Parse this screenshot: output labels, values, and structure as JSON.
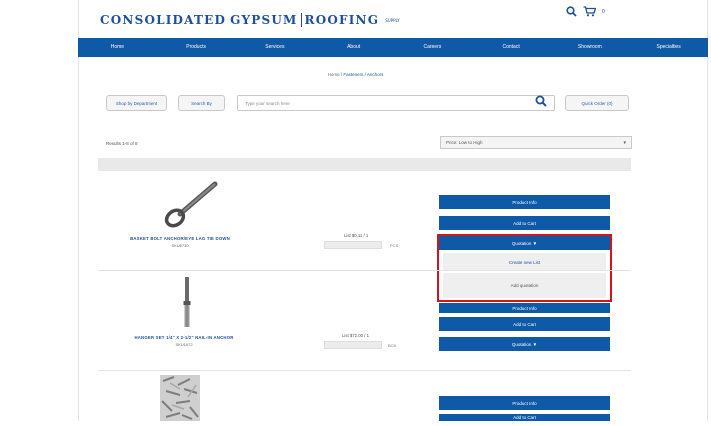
{
  "header": {
    "brand": {
      "word1": "CONSOLIDATED",
      "word2": "GYPSUM",
      "word3": "ROOFING",
      "suffix": "SUPPLY"
    },
    "cart_count": "0"
  },
  "nav": {
    "items": [
      "Home",
      "Products",
      "Services",
      "About",
      "Careers",
      "Contact",
      "Showroom",
      "Specialties"
    ]
  },
  "breadcrumb": {
    "home": "Home",
    "path": " / Fasteners / Anchors"
  },
  "toolbar": {
    "shop_by_department": "Shop by Department",
    "search_by": "Search By",
    "search_placeholder": "Type your search here",
    "quick_order": "Quick Order (0)"
  },
  "results": {
    "count_label": "Results 1-8 of 8",
    "sort_selected": "Price: Low to High"
  },
  "products": [
    {
      "name": "BASKET BOLT ANCHOR/EYE LAG TIE DOWN",
      "sku": "SKU6730",
      "price": "List $0.11 / 1",
      "uom": "PCS",
      "buttons": [
        "Product Info",
        "Add to Cart",
        "Quotation ▼"
      ],
      "dropdown": [
        "Create new List",
        "Add quotation"
      ]
    },
    {
      "name": "HANGER SET 1/4\" X 2-1/2\" NAIL-IN ANCHOR",
      "sku": "SKU1672",
      "price": "List $72.00 / 1",
      "uom": "BOX",
      "buttons": [
        "Product Info",
        "Add to Cart",
        "Quotation ▼"
      ]
    },
    {
      "name": "",
      "sku": "",
      "buttons": [
        "Product Info",
        "Add to Cart"
      ]
    }
  ],
  "colors": {
    "brand_blue": "#0f5aa7",
    "highlight_red": "#d4141c"
  },
  "icons": {
    "search": "search-icon",
    "cart": "cart-icon",
    "sort_caret": "chevron-down-icon"
  }
}
